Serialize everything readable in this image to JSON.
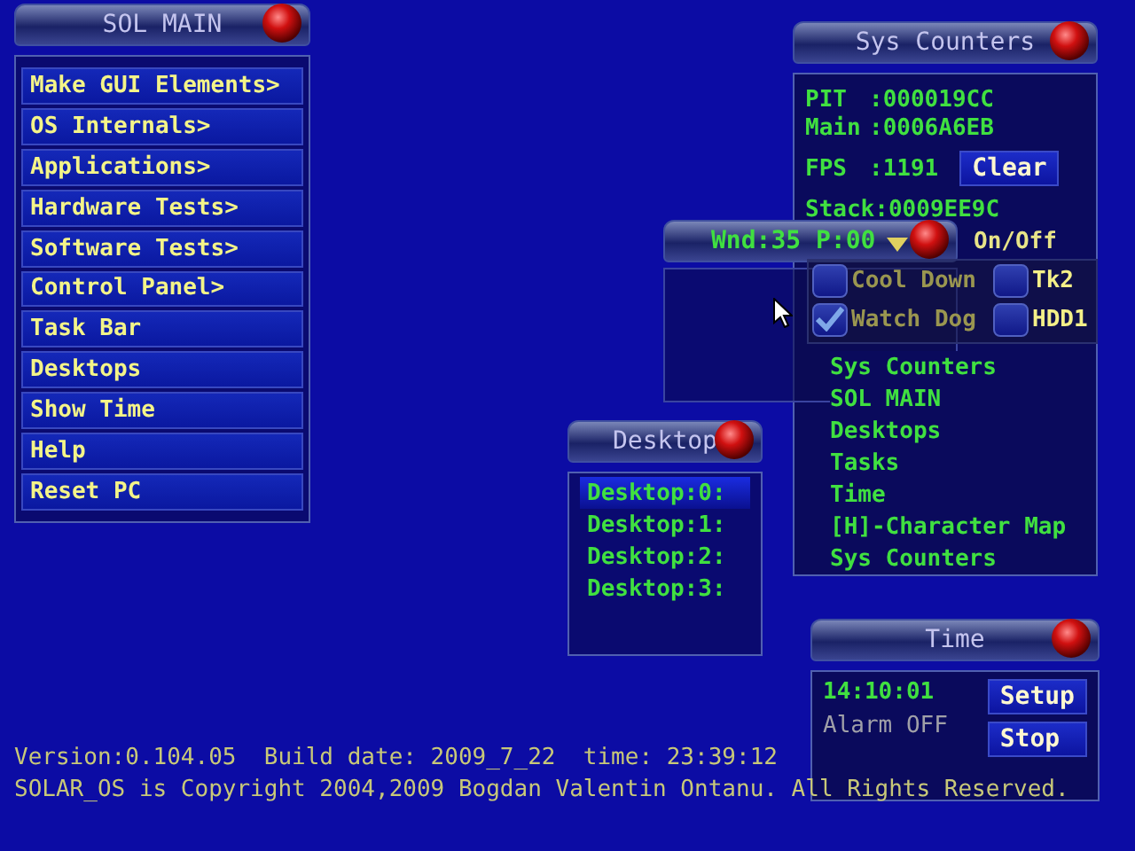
{
  "sol_main": {
    "title": "SOL MAIN",
    "items": [
      "Make GUI Elements>",
      "OS Internals>",
      "Applications>",
      "Hardware Tests>",
      "Software Tests>",
      "Control Panel>",
      "Task Bar",
      "Desktops",
      "Show Time",
      "Help",
      "Reset PC"
    ]
  },
  "sys_counters": {
    "title": "Sys Counters",
    "counters": [
      {
        "label": "PIT",
        "value": ":000019CC"
      },
      {
        "label": "Main",
        "value": ":0006A6EB"
      },
      {
        "label": "FPS",
        "value": ":1191"
      },
      {
        "label": "Stack",
        "value": ":0009EE9C"
      }
    ],
    "clear_button": "Clear",
    "tasks": [
      "Sys Counters",
      "SOL MAIN",
      "Desktops",
      "Tasks",
      "Time",
      "[H]-Character Map",
      "Sys Counters"
    ]
  },
  "wnd": {
    "title": "Wnd:35 P:00"
  },
  "on_off": {
    "label": "On/Off",
    "checkboxes": [
      {
        "label": "Cool Down",
        "checked": false
      },
      {
        "label": "Watch Dog",
        "checked": true
      },
      {
        "label": "Tk2",
        "checked": false
      },
      {
        "label": "HDD1",
        "checked": false
      }
    ]
  },
  "desktop": {
    "title": "Desktop",
    "items": [
      {
        "label": "Desktop:0:",
        "selected": true
      },
      {
        "label": "Desktop:1:",
        "selected": false
      },
      {
        "label": "Desktop:2:",
        "selected": false
      },
      {
        "label": "Desktop:3:",
        "selected": false
      }
    ]
  },
  "time": {
    "title": "Time",
    "clock": "14:10:01",
    "alarm": "Alarm OFF",
    "buttons": [
      "Setup",
      "Stop"
    ]
  },
  "footer": {
    "version_line": "Version:0.104.05  Build date: 2009_7_22  time: 23:39:12",
    "copyright": "SOLAR_OS is Copyright 2004,2009 Bogdan Valentin Ontanu. All Rights Reserved."
  }
}
